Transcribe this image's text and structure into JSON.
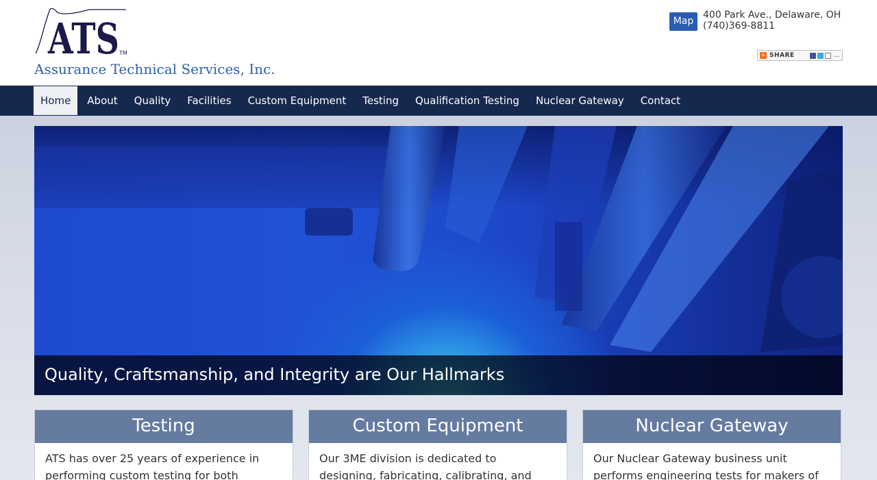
{
  "header": {
    "logo_text": "ATS",
    "logo_tm": "TM",
    "company_name": "Assurance Technical Services, Inc.",
    "map_button": "Map",
    "address_line1": "400 Park Ave., Delaware, OH",
    "address_line2": "(740)369-8811",
    "share_label": "SHARE"
  },
  "nav": {
    "items": [
      {
        "label": "Home",
        "active": true
      },
      {
        "label": "About"
      },
      {
        "label": "Quality"
      },
      {
        "label": "Facilities"
      },
      {
        "label": "Custom Equipment"
      },
      {
        "label": "Testing"
      },
      {
        "label": "Qualification Testing"
      },
      {
        "label": "Nuclear Gateway"
      },
      {
        "label": "Contact"
      }
    ]
  },
  "hero": {
    "caption": "Quality, Craftsmanship, and Integrity are Our Hallmarks"
  },
  "cards": [
    {
      "title": "Testing",
      "body": "ATS has over 25 years of experience in performing custom testing for both"
    },
    {
      "title": "Custom Equipment",
      "body": "Our 3ME division is dedicated to designing, fabricating, calibrating, and validating"
    },
    {
      "title": "Nuclear Gateway",
      "body": "Our Nuclear Gateway business unit performs engineering tests for makers of"
    }
  ],
  "colors": {
    "brand_blue": "#2e5fae",
    "nav_bg": "#16284d",
    "card_header": "#657ba0",
    "map_button": "#2a5db0"
  }
}
